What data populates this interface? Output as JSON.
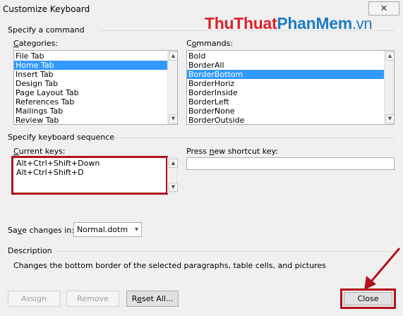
{
  "window": {
    "title": "Customize Keyboard",
    "close_glyph": "✕"
  },
  "watermark": {
    "thu": "ThuThuat",
    "phan": "PhanMem",
    "vn": ".vn"
  },
  "command": {
    "section_label": "Specify a command",
    "categories_label": "Categories:",
    "categories": [
      "File Tab",
      "Home Tab",
      "Insert Tab",
      "Design Tab",
      "Page Layout Tab",
      "References Tab",
      "Mailings Tab",
      "Review Tab"
    ],
    "categories_selected_index": 1,
    "commands_label": "Commands:",
    "commands": [
      "Bold",
      "BorderAll",
      "BorderBottom",
      "BorderHoriz",
      "BorderInside",
      "BorderLeft",
      "BorderNone",
      "BorderOutside"
    ],
    "commands_selected_index": 2
  },
  "keyboard": {
    "section_label": "Specify keyboard sequence",
    "current_keys_label": "Current keys:",
    "current_keys": [
      "Alt+Ctrl+Shift+Down",
      "Alt+Ctrl+Shift+D"
    ],
    "new_key_label": "Press new shortcut key:",
    "new_key_value": ""
  },
  "save": {
    "label": "Save changes in:",
    "value": "Normal.dotm"
  },
  "description": {
    "label": "Description",
    "text": "Changes the bottom border of the selected paragraphs, table cells, and pictures"
  },
  "buttons": {
    "assign": "Assign",
    "remove": "Remove",
    "reset_all": "Reset All...",
    "close": "Close"
  },
  "icons": {
    "scroll_up": "▲",
    "scroll_down": "▼",
    "dropdown": "▾"
  },
  "accent": {
    "selection": "#3399ff",
    "annotation": "#b0121b"
  }
}
